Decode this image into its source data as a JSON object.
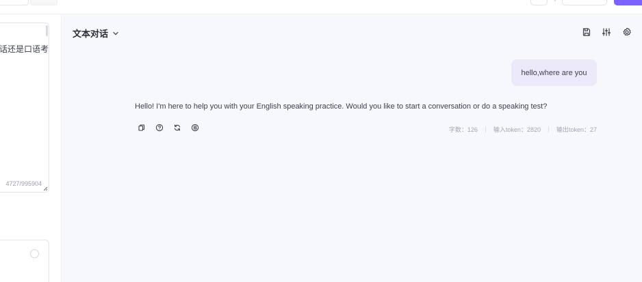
{
  "chat": {
    "title": "文本对话",
    "messages": {
      "user": "hello,where are you",
      "assistant": "Hello! I'm here to help you with your English speaking practice. Would you like to start a conversation or do a speaking test?"
    },
    "stats": {
      "chars": "字数：126",
      "input_tokens": "输入token：2820",
      "output_tokens": "输出token：27"
    }
  },
  "left": {
    "prompt_excerpt": "话还是口语考",
    "prompt_count": "4727/995904"
  },
  "colors": {
    "accent": "#7b61ff",
    "user_bubble": "#ece9fb",
    "chat_bg": "#f7f8fc"
  },
  "icons": {
    "header": [
      "save-icon",
      "sliders-icon",
      "settings-gear-icon"
    ],
    "message_actions": [
      "copy-icon",
      "help-icon",
      "refresh-icon",
      "brand-icon"
    ]
  }
}
